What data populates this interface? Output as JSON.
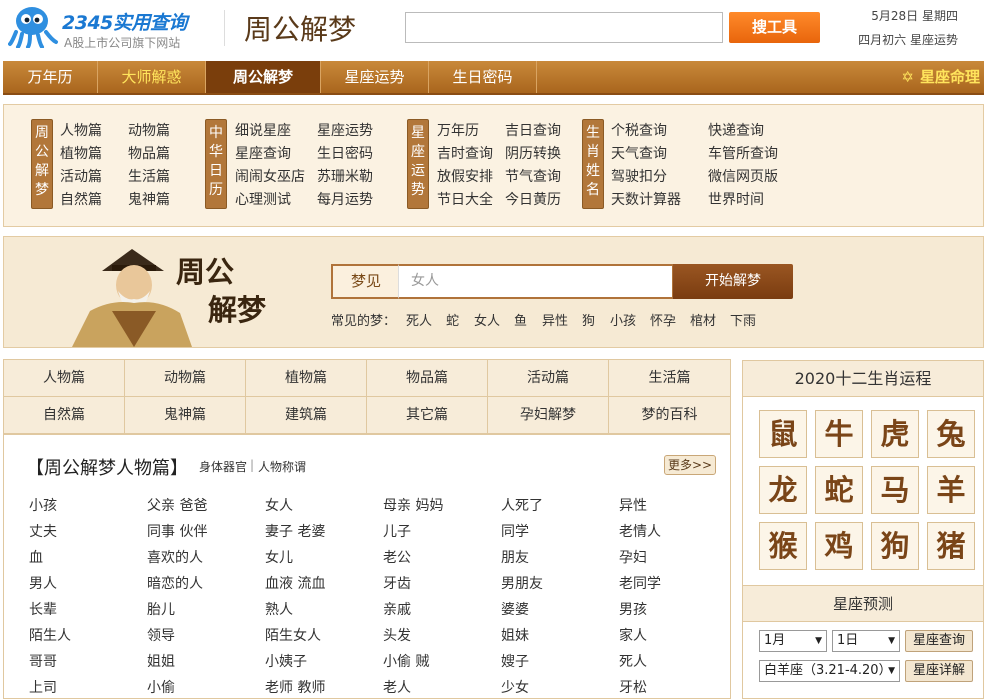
{
  "header": {
    "brand": "2345实用查询",
    "slogan": "A股上市公司旗下网站",
    "site_title": "周公解梦",
    "search_value": "",
    "search_button": "搜工具",
    "date": "5月28日  星期四",
    "lunar": "四月初六  星座运势"
  },
  "nav": {
    "items": [
      "万年历",
      "大师解惑",
      "周公解梦",
      "星座运势",
      "生日密码"
    ],
    "right": "星座命理"
  },
  "links": {
    "groups": [
      {
        "label": "周公解梦",
        "col1": [
          "人物篇",
          "植物篇",
          "活动篇",
          "自然篇"
        ],
        "col2": [
          "动物篇",
          "物品篇",
          "生活篇",
          "鬼神篇"
        ]
      },
      {
        "label": "中华日历",
        "col1": [
          "细说星座",
          "星座查询",
          "闹闹女巫店",
          "心理测试"
        ],
        "col2": [
          "星座运势",
          "生日密码",
          "苏珊米勒",
          "每月运势"
        ]
      },
      {
        "label": "星座运势",
        "col1": [
          "万年历",
          "吉时查询",
          "放假安排",
          "节日大全"
        ],
        "col2": [
          "吉日查询",
          "阴历转换",
          "节气查询",
          "今日黄历"
        ]
      },
      {
        "label": "生肖姓名",
        "col1": [
          "个税查询",
          "天气查询",
          "驾驶扣分",
          "天数计算器"
        ],
        "col2": [
          "快递查询",
          "车管所查询",
          "微信网页版",
          "世界时间"
        ]
      }
    ]
  },
  "dream": {
    "title_top": "周公",
    "title_bottom": "解梦",
    "label": "梦见",
    "input_value": "女人",
    "button": "开始解梦",
    "common_label": "常见的梦：",
    "common": [
      "死人",
      "蛇",
      "女人",
      "鱼",
      "异性",
      "狗",
      "小孩",
      "怀孕",
      "棺材",
      "下雨"
    ]
  },
  "categories": [
    "人物篇",
    "动物篇",
    "植物篇",
    "物品篇",
    "活动篇",
    "生活篇",
    "自然篇",
    "鬼神篇",
    "建筑篇",
    "其它篇",
    "孕妇解梦",
    "梦的百科"
  ],
  "people": {
    "title": "【周公解梦人物篇】",
    "sub1": "身体器官",
    "sub_sep": "|",
    "sub2": "人物称谓",
    "more": "更多>>",
    "rows": [
      [
        "小孩",
        "父亲 爸爸",
        "女人",
        "母亲 妈妈",
        "人死了",
        "异性"
      ],
      [
        "丈夫",
        "同事 伙伴",
        "妻子 老婆",
        "儿子",
        "同学",
        "老情人"
      ],
      [
        "血",
        "喜欢的人",
        "女儿",
        "老公",
        "朋友",
        "孕妇"
      ],
      [
        "男人",
        "暗恋的人",
        "血液 流血",
        "牙齿",
        "男朋友",
        "老同学"
      ],
      [
        "长辈",
        "胎儿",
        "熟人",
        "亲戚",
        "婆婆",
        "男孩"
      ],
      [
        "陌生人",
        "领导",
        "陌生女人",
        "头发",
        "姐妹",
        "家人"
      ],
      [
        "哥哥",
        "姐姐",
        "小姨子",
        "小偷 贼",
        "嫂子",
        "死人"
      ],
      [
        "上司",
        "小偷",
        "老师 教师",
        "老人",
        "少女",
        "牙松"
      ]
    ]
  },
  "zodiac": {
    "title": "2020十二生肖运程",
    "animals": [
      "鼠",
      "牛",
      "虎",
      "兔",
      "龙",
      "蛇",
      "马",
      "羊",
      "猴",
      "鸡",
      "狗",
      "猪"
    ]
  },
  "star": {
    "title": "星座预测",
    "month": "1月",
    "day": "1日",
    "query_button": "星座查询",
    "sign": "白羊座（3.21-4.20）",
    "detail_button": "星座详解"
  }
}
